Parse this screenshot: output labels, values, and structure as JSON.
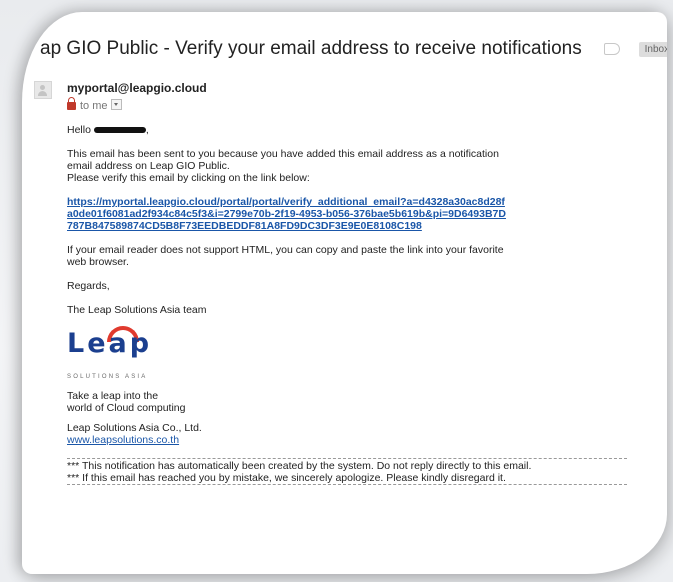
{
  "email": {
    "subject": "ap GIO Public - Verify your email address to receive notifications",
    "label_chip": "Inbox",
    "label_chip_close": "x",
    "sender": "myportal@leapgio.cloud",
    "to_line": "to me",
    "greeting": "Hello",
    "greeting_suffix": ",",
    "para1_line1": "This email has been sent to you because you have added this email address as a notification",
    "para1_line2": "email address on Leap GIO Public.",
    "para1_line3": "Please verify this email by clicking on the link below:",
    "verify_link": "https://myportal.leapgio.cloud/portal/portal/verify_additional_email?a=d4328a30ac8d28fa0de01f6081ad2f934c84c5f3&i=2799e70b-2f19-4953-b056-376bae5b619b&pi=9D6493B7D787B847589874CD5B8F73EEDBEDDF81A8FD9DC3DF3E9E0E8108C198",
    "para2_line1": "If your email reader does not support HTML, you can copy and paste the link into your favorite",
    "para2_line2": "web browser.",
    "regards": "Regards,",
    "team": "The Leap Solutions Asia team",
    "logo": {
      "word": "Leap",
      "tagline": "SOLUTIONS ASIA",
      "accent_color": "#e03a2e",
      "brand_color": "#1b3f8f"
    },
    "slogan_line1": "Take a leap into the",
    "slogan_line2": "world of Cloud computing",
    "company": "Leap Solutions Asia Co., Ltd.",
    "website": "www.leapsolutions.co.th",
    "notice1": "*** This notification has automatically been created by the system. Do not reply directly to this email.",
    "notice2": "*** If this email has reached you by mistake, we sincerely apologize. Please kindly disregard it."
  }
}
